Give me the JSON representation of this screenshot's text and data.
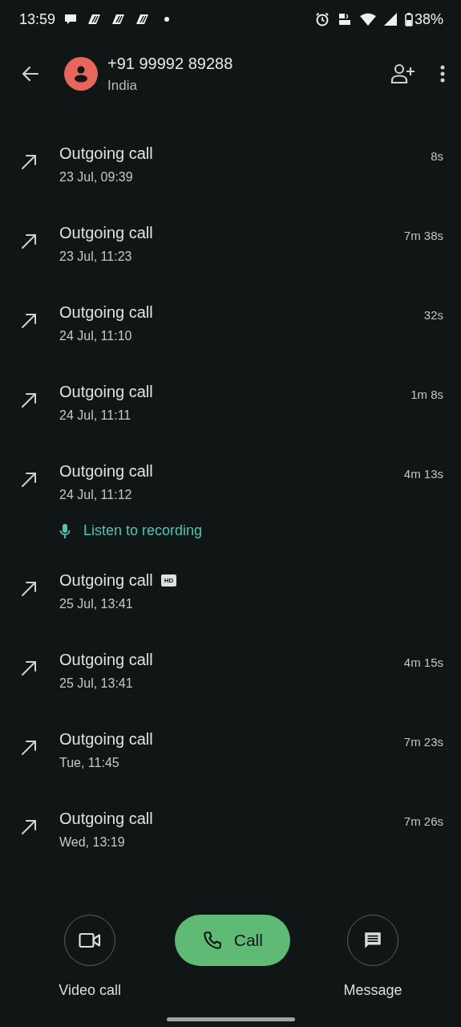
{
  "status_bar": {
    "time": "13:59",
    "battery": "38%"
  },
  "header": {
    "number": "+91 99992 89288",
    "location": "India"
  },
  "calls": [
    {
      "kind": "outgoing",
      "title": "Outgoing call",
      "time": "23 Jul, 09:39",
      "duration": "8s"
    },
    {
      "kind": "outgoing",
      "title": "Outgoing call",
      "time": "23 Jul, 11:23",
      "duration": "7m 38s"
    },
    {
      "kind": "outgoing",
      "title": "Outgoing call",
      "time": "24 Jul, 11:10",
      "duration": "32s"
    },
    {
      "kind": "outgoing",
      "title": "Outgoing call",
      "time": "24 Jul, 11:11",
      "duration": "1m 8s"
    },
    {
      "kind": "outgoing",
      "title": "Outgoing call",
      "time": "24 Jul, 11:12",
      "duration": "4m 13s",
      "recording": "Listen to recording"
    },
    {
      "kind": "outgoing",
      "title": "Outgoing call",
      "time": "25 Jul, 13:41",
      "badge": "HD"
    },
    {
      "kind": "outgoing",
      "title": "Outgoing call",
      "time": "25 Jul, 13:41",
      "duration": "4m 15s"
    },
    {
      "kind": "outgoing",
      "title": "Outgoing call",
      "time": "Tue, 11:45",
      "duration": "7m 23s"
    },
    {
      "kind": "outgoing",
      "title": "Outgoing call",
      "time": "Wed, 13:19",
      "duration": "7m 26s"
    }
  ],
  "actions": [
    {
      "kind": "video",
      "label": "Video call"
    },
    {
      "kind": "call",
      "label": "Call"
    },
    {
      "kind": "message",
      "label": "Message"
    }
  ]
}
